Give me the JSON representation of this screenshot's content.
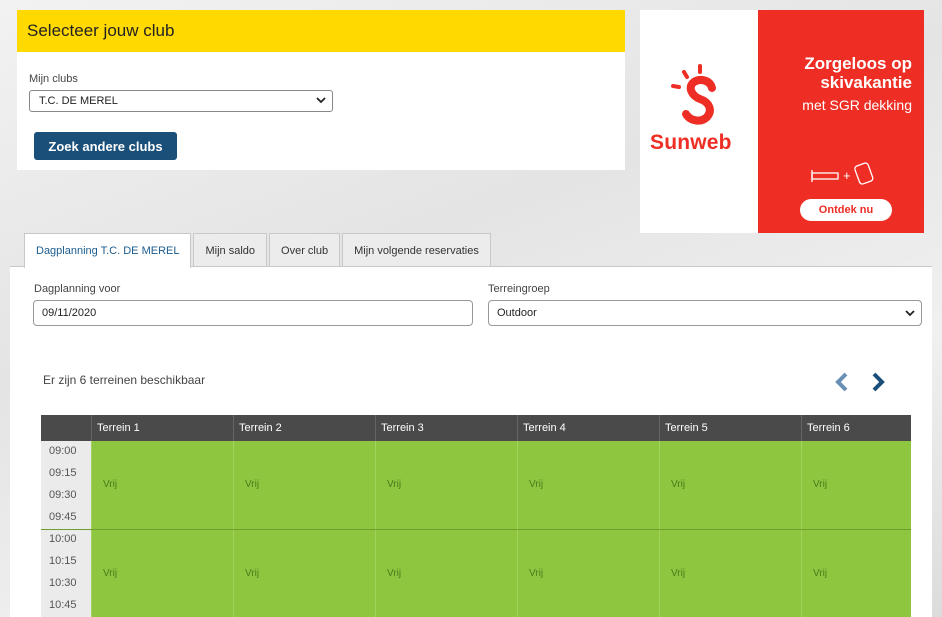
{
  "club_card": {
    "header": "Selecteer jouw club",
    "label": "Mijn clubs",
    "selected_club": "T.C. DE MEREL",
    "button": "Zoek andere clubs"
  },
  "ad": {
    "brand": "Sunweb",
    "headline_1": "Zorgeloos op",
    "headline_2": "skivakantie",
    "subline": "met SGR dekking",
    "cta": "Ontdek nu",
    "icon_plus": "+"
  },
  "tabs": [
    {
      "label": "Dagplanning T.C. DE MEREL",
      "active": true
    },
    {
      "label": "Mijn saldo",
      "active": false
    },
    {
      "label": "Over club",
      "active": false
    },
    {
      "label": "Mijn volgende reservaties",
      "active": false
    }
  ],
  "planning": {
    "date_label": "Dagplanning voor",
    "date_value": "09/11/2020",
    "group_label": "Terreingroep",
    "group_value": "Outdoor",
    "availability": "Er zijn 6 terreinen beschikbaar"
  },
  "grid": {
    "courts": [
      "Terrein 1",
      "Terrein 2",
      "Terrein 3",
      "Terrein 4",
      "Terrein 5",
      "Terrein 6"
    ],
    "times": [
      "09:00",
      "09:15",
      "09:30",
      "09:45",
      "10:00",
      "10:15",
      "10:30",
      "10:45"
    ],
    "slot_label": "Vrij",
    "colors": {
      "free": "#8ec63f",
      "header": "#4a4a4a"
    }
  },
  "colors": {
    "accent_yellow": "#ffd900",
    "button_blue": "#1a4f7a",
    "ad_red": "#ee2e24"
  }
}
